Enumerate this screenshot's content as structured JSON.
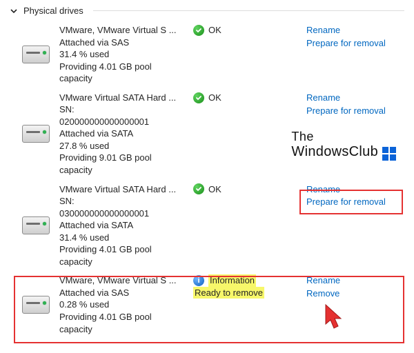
{
  "section": {
    "title": "Physical drives"
  },
  "status_labels": {
    "ok": "OK",
    "information": "Information",
    "ready": "Ready to remove"
  },
  "actions": {
    "rename": "Rename",
    "prepare": "Prepare for removal",
    "remove": "Remove"
  },
  "drives": [
    {
      "name": "VMware, VMware Virtual S ...",
      "attached": "Attached via SAS",
      "used": "31.4 % used",
      "capacity1": "Providing 4.01 GB pool",
      "capacity2": "capacity"
    },
    {
      "name": "VMware Virtual SATA Hard ...",
      "sn_label": "SN:",
      "sn": "020000000000000001",
      "attached": "Attached via SATA",
      "used": "27.8 % used",
      "capacity1": "Providing 9.01 GB pool",
      "capacity2": "capacity"
    },
    {
      "name": "VMware Virtual SATA Hard ...",
      "sn_label": "SN:",
      "sn": "030000000000000001",
      "attached": "Attached via SATA",
      "used": "31.4 % used",
      "capacity1": "Providing 4.01 GB pool",
      "capacity2": "capacity"
    },
    {
      "name": "VMware, VMware Virtual S ...",
      "attached": "Attached via SAS",
      "used": "0.28 % used",
      "capacity1": "Providing 4.01 GB pool",
      "capacity2": "capacity"
    }
  ],
  "watermark": {
    "line1": "The",
    "line2": "WindowsClub"
  }
}
